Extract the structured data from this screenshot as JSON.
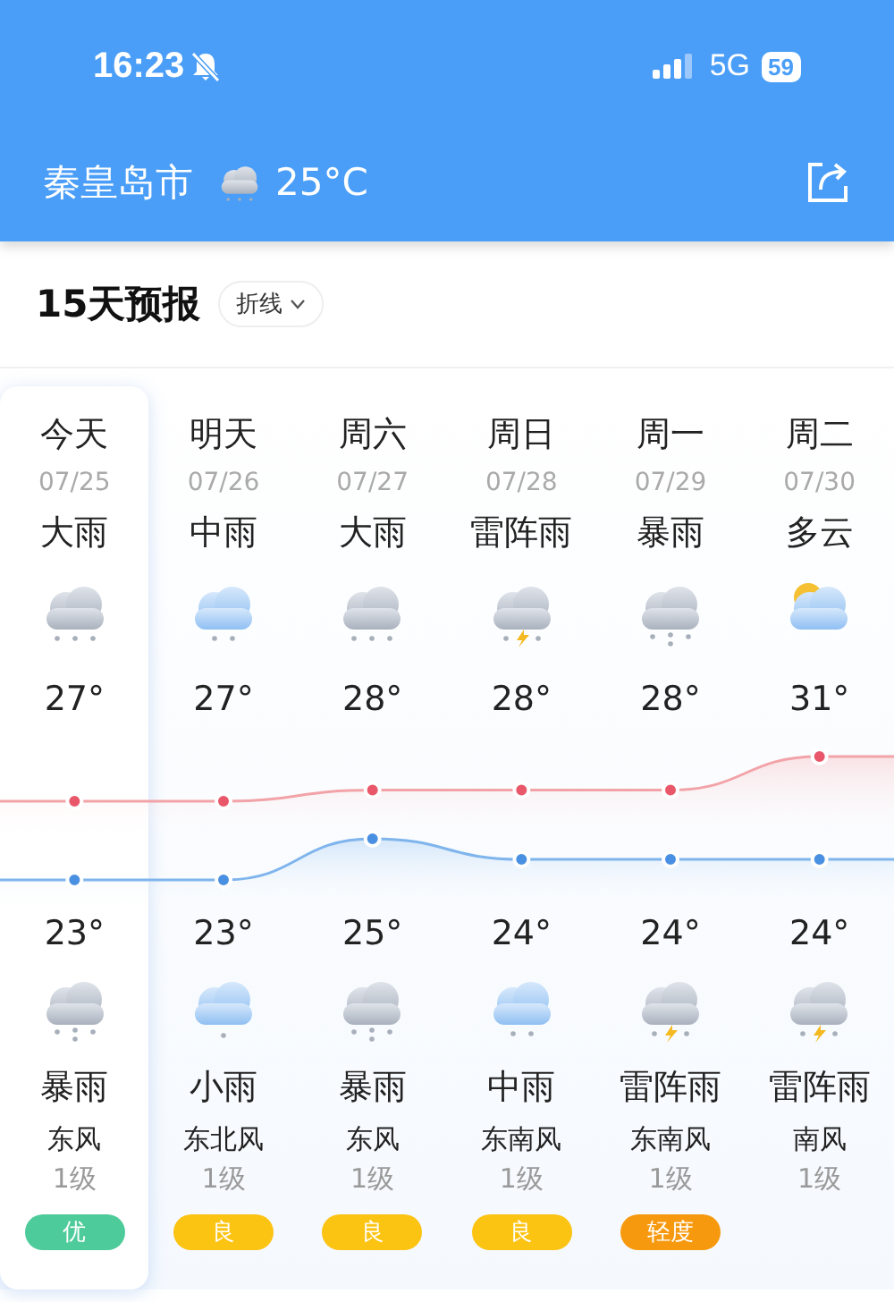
{
  "status_bar": {
    "time": "16:23",
    "network": "5G",
    "battery": "59"
  },
  "header": {
    "city": "秦皇岛市",
    "temperature": "25°C"
  },
  "forecast": {
    "title": "15天预报",
    "view_mode": "折线",
    "days": [
      {
        "name": "今天",
        "date": "07/25",
        "day_condition": "大雨",
        "day_weather": {
          "kind": "rain3"
        },
        "high": "27°",
        "low": "23°",
        "night_weather": {
          "kind": "storm"
        },
        "night_condition": "暴雨",
        "wind": "东风",
        "wind_level": "1级",
        "aqi": {
          "label": "优",
          "color": "#4ecb9a"
        },
        "selected": true
      },
      {
        "name": "明天",
        "date": "07/26",
        "day_condition": "中雨",
        "day_weather": {
          "kind": "rain2"
        },
        "high": "27°",
        "low": "23°",
        "night_weather": {
          "kind": "rain1"
        },
        "night_condition": "小雨",
        "wind": "东北风",
        "wind_level": "1级",
        "aqi": {
          "label": "良",
          "color": "#fbc312"
        },
        "selected": false
      },
      {
        "name": "周六",
        "date": "07/27",
        "day_condition": "大雨",
        "day_weather": {
          "kind": "rain3"
        },
        "high": "28°",
        "low": "25°",
        "night_weather": {
          "kind": "storm"
        },
        "night_condition": "暴雨",
        "wind": "东风",
        "wind_level": "1级",
        "aqi": {
          "label": "良",
          "color": "#fbc312"
        },
        "selected": false
      },
      {
        "name": "周日",
        "date": "07/28",
        "day_condition": "雷阵雨",
        "day_weather": {
          "kind": "thunder"
        },
        "high": "28°",
        "low": "24°",
        "night_weather": {
          "kind": "rain2"
        },
        "night_condition": "中雨",
        "wind": "东南风",
        "wind_level": "1级",
        "aqi": {
          "label": "良",
          "color": "#fbc312"
        },
        "selected": false
      },
      {
        "name": "周一",
        "date": "07/29",
        "day_condition": "暴雨",
        "day_weather": {
          "kind": "storm"
        },
        "high": "28°",
        "low": "24°",
        "night_weather": {
          "kind": "thunder"
        },
        "night_condition": "雷阵雨",
        "wind": "东南风",
        "wind_level": "1级",
        "aqi": {
          "label": "轻度",
          "color": "#f7990f"
        },
        "selected": false
      },
      {
        "name": "周二",
        "date": "07/30",
        "day_condition": "多云",
        "day_weather": {
          "kind": "cloudsun"
        },
        "high": "31°",
        "low": "24°",
        "night_weather": {
          "kind": "thunder"
        },
        "night_condition": "雷阵雨",
        "wind": "南风",
        "wind_level": "1级",
        "selected": false
      }
    ]
  }
}
